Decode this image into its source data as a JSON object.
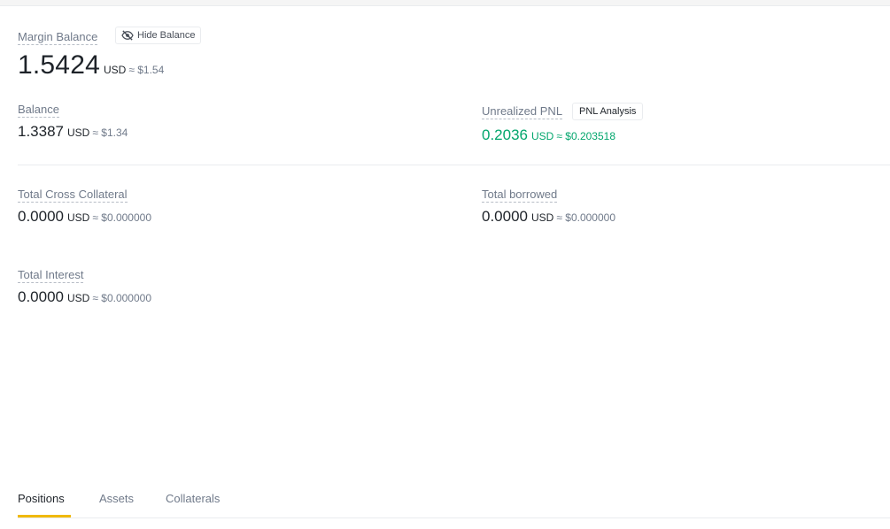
{
  "margin_balance": {
    "label": "Margin Balance",
    "hide_button_label": "Hide Balance",
    "value": "1.5424",
    "unit": "USD",
    "approx": "≈ $1.54"
  },
  "balance": {
    "label": "Balance",
    "value": "1.3387",
    "unit": "USD",
    "approx": "≈ $1.34"
  },
  "unrealized_pnl": {
    "label": "Unrealized PNL",
    "button_label": "PNL Analysis",
    "value": "0.2036",
    "unit": "USD",
    "approx": "≈ $0.203518",
    "color": "#03a66d"
  },
  "total_cross_collateral": {
    "label": "Total Cross Collateral",
    "value": "0.0000",
    "unit": "USD",
    "approx": "≈ $0.000000"
  },
  "total_borrowed": {
    "label": "Total borrowed",
    "value": "0.0000",
    "unit": "USD",
    "approx": "≈ $0.000000"
  },
  "total_interest": {
    "label": "Total Interest",
    "value": "0.0000",
    "unit": "USD",
    "approx": "≈ $0.000000"
  },
  "tabs": [
    {
      "label": "Positions",
      "active": true
    },
    {
      "label": "Assets",
      "active": false
    },
    {
      "label": "Collaterals",
      "active": false
    }
  ],
  "colors": {
    "accent": "#f0b90b",
    "positive": "#03a66d",
    "muted": "#707a8a"
  },
  "icons": {
    "hide_balance": "eye-off-icon"
  }
}
